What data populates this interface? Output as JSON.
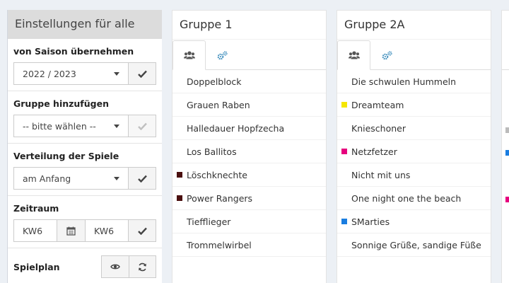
{
  "settings": {
    "title": "Einstellungen für alle",
    "season": {
      "label": "von Saison übernehmen",
      "value": "2022 / 2023"
    },
    "add_group": {
      "label": "Gruppe hinzufügen",
      "placeholder": "-- bitte wählen --"
    },
    "distribution": {
      "label": "Verteilung der Spiele",
      "value": "am Anfang"
    },
    "period": {
      "label": "Zeitraum",
      "from": "KW6",
      "to": "KW6"
    },
    "schedule": {
      "label": "Spielplan"
    }
  },
  "groups": [
    {
      "title": "Gruppe 1",
      "teams": [
        {
          "name": "Doppelblock",
          "color": ""
        },
        {
          "name": "Grauen Raben",
          "color": ""
        },
        {
          "name": "Halledauer Hopfzecha",
          "color": ""
        },
        {
          "name": "Los Ballitos",
          "color": ""
        },
        {
          "name": "Löschknechte",
          "color": "#4a0f0f"
        },
        {
          "name": "Power Rangers",
          "color": "#4a0f0f"
        },
        {
          "name": "Tiefflieger",
          "color": ""
        },
        {
          "name": "Trommelwirbel",
          "color": ""
        }
      ]
    },
    {
      "title": "Gruppe 2A",
      "teams": [
        {
          "name": "Die schwulen Hummeln",
          "color": ""
        },
        {
          "name": "Dreamteam",
          "color": "#f5e600"
        },
        {
          "name": "Knieschoner",
          "color": ""
        },
        {
          "name": "Netzfetzer",
          "color": "#e6007e"
        },
        {
          "name": "Nicht mit uns",
          "color": ""
        },
        {
          "name": "One night one the beach",
          "color": ""
        },
        {
          "name": "SMarties",
          "color": "#1a7de0"
        },
        {
          "name": "Sonnige Grüße, sandige Füße",
          "color": ""
        }
      ]
    }
  ],
  "partial_group_markers": [
    "#bbbbbb",
    "#1a7de0",
    "#e6007e"
  ],
  "icons": {
    "checkmark": "check-icon",
    "calendar": "calendar-icon",
    "eye": "eye-icon",
    "refresh": "refresh-icon",
    "team_tab": "users-icon",
    "settings_tab": "cogs-icon"
  },
  "colors": {
    "accent_blue": "#3c8dbc",
    "icon_gray": "#555555"
  }
}
